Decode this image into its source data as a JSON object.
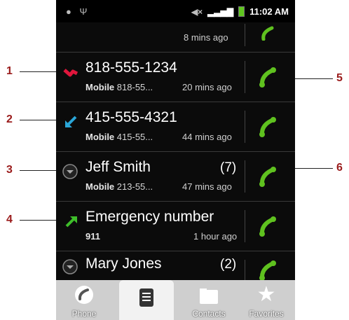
{
  "status_bar": {
    "time": "11:02 AM"
  },
  "partial_top_row": {
    "time": "8 mins ago"
  },
  "call_log": [
    {
      "title": "818-555-1234",
      "count": "",
      "sub_label": "Mobile",
      "sub_number": "818-55...",
      "time": "20 mins ago",
      "type": "missed"
    },
    {
      "title": "415-555-4321",
      "count": "",
      "sub_label": "Mobile",
      "sub_number": "415-55...",
      "time": "44 mins ago",
      "type": "incoming"
    },
    {
      "title": "Jeff Smith",
      "count": "(7)",
      "sub_label": "Mobile",
      "sub_number": "213-55...",
      "time": "47 mins ago",
      "type": "group"
    },
    {
      "title": "Emergency number",
      "count": "",
      "sub_label": "911",
      "sub_number": "",
      "time": "1 hour ago",
      "type": "outgoing"
    },
    {
      "title": "Mary Jones",
      "count": "(2)",
      "sub_label": "",
      "sub_number": "",
      "time": "",
      "type": "group"
    }
  ],
  "tabs": [
    {
      "label": "Phone",
      "icon": "phone-icon"
    },
    {
      "label": "",
      "icon": "call-log-icon",
      "selected": true
    },
    {
      "label": "Contacts",
      "icon": "contacts-icon"
    },
    {
      "label": "Favorites",
      "icon": "star-icon"
    }
  ],
  "callouts": [
    "1",
    "2",
    "3",
    "4",
    "5",
    "6"
  ],
  "colors": {
    "missed": "#e0163c",
    "incoming": "#2aa6d8",
    "outgoing": "#3ebd2a",
    "call_button": "#5fc11f"
  }
}
